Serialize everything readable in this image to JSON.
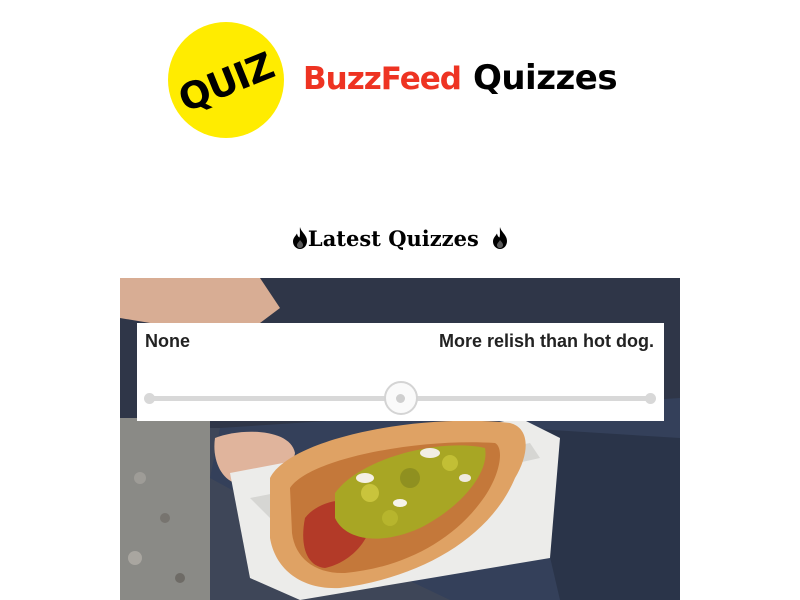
{
  "header": {
    "badge_text": "QUIZ",
    "brand_name": "BuzzFeed",
    "brand_section": "Quizzes",
    "brand_color": "#ee3322",
    "badge_color": "#ffec00"
  },
  "section": {
    "title": "Latest Quizzes",
    "icon": "fire-icon"
  },
  "quiz_card": {
    "image_subject": "hot-dog-with-relish",
    "slider": {
      "min_label": "None",
      "max_label": "More relish than hot dog.",
      "value_fraction": 0.5
    }
  }
}
